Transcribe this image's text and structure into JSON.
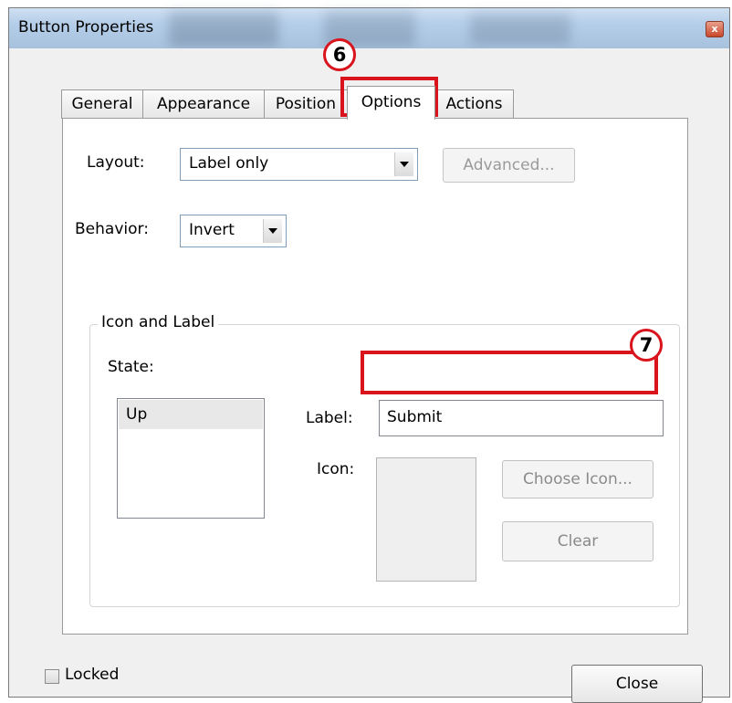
{
  "window": {
    "title": "Button Properties",
    "close_glyph": "x"
  },
  "tabs": [
    {
      "label": "General"
    },
    {
      "label": "Appearance"
    },
    {
      "label": "Position"
    },
    {
      "label": "Options"
    },
    {
      "label": "Actions"
    }
  ],
  "active_tab": "Options",
  "options": {
    "layout_label": "Layout:",
    "layout_value": "Label only",
    "advanced_button": "Advanced...",
    "behavior_label": "Behavior:",
    "behavior_value": "Invert",
    "group_title": "Icon and Label",
    "state_label": "State:",
    "state_items": [
      "Up"
    ],
    "label_label": "Label:",
    "label_value": "Submit",
    "icon_label": "Icon:",
    "choose_icon_button": "Choose Icon...",
    "clear_button": "Clear"
  },
  "footer": {
    "locked_label": "Locked",
    "locked_checked": false,
    "close_button": "Close"
  },
  "annotations": [
    {
      "number": "6",
      "target": "Options tab"
    },
    {
      "number": "7",
      "target": "Label field"
    }
  ],
  "colors": {
    "highlight_red": "#d9141c",
    "titlebar": "#b4cde8"
  }
}
